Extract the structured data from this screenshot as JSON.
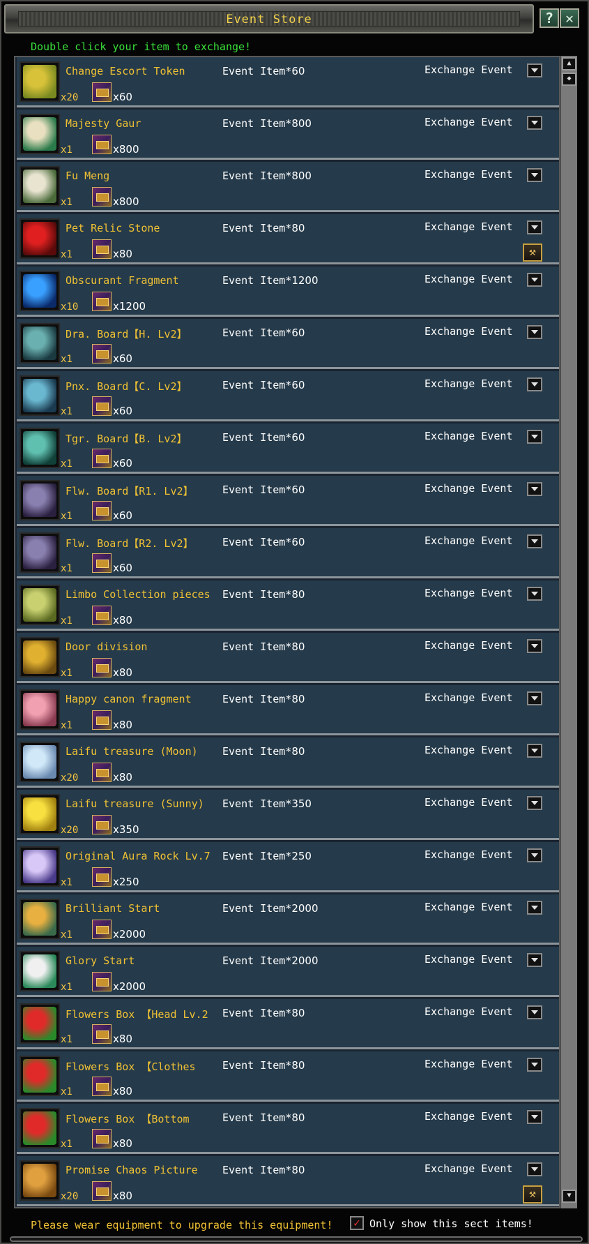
{
  "window": {
    "title": "Event Store",
    "help_label": "?",
    "close_label": "✕",
    "hint": "Double click your item to exchange!"
  },
  "items": [
    {
      "name": "Change Escort Token",
      "qty": "x20",
      "cost_qty": "x60",
      "price_label": "Event Item*",
      "price": "60",
      "exchange": "Exchange Event",
      "icon": "escort-token-icon",
      "colors": [
        "#d8c23a",
        "#7a8a20"
      ]
    },
    {
      "name": "Majesty Gaur",
      "qty": "x1",
      "cost_qty": "x800",
      "price_label": "Event Item*",
      "price": "800",
      "exchange": "Exchange Event",
      "icon": "gaur-mount-icon",
      "colors": [
        "#e8e0c0",
        "#2a7a4a"
      ]
    },
    {
      "name": "Fu Meng",
      "qty": "x1",
      "cost_qty": "x800",
      "price_label": "Event Item*",
      "price": "800",
      "exchange": "Exchange Event",
      "icon": "fu-meng-mount-icon",
      "colors": [
        "#e8e4d0",
        "#4a6a3a"
      ]
    },
    {
      "name": "Pet Relic Stone",
      "qty": "x1",
      "cost_qty": "x80",
      "price_label": "Event Item*",
      "price": "80",
      "exchange": "Exchange Event",
      "icon": "relic-stone-icon",
      "colors": [
        "#e02020",
        "#5a0a0a"
      ],
      "upgrade": true
    },
    {
      "name": "Obscurant Fragment",
      "qty": "x10",
      "cost_qty": "x1200",
      "price_label": "Event Item*",
      "price": "1200",
      "exchange": "Exchange Event",
      "icon": "crystal-fragment-icon",
      "colors": [
        "#3aa0ff",
        "#0a2a6a"
      ]
    },
    {
      "name": "Dra. Board【H. Lv2】",
      "qty": "x1",
      "cost_qty": "x60",
      "price_label": "Event Item*",
      "price": "60",
      "exchange": "Exchange Event",
      "icon": "board-icon",
      "colors": [
        "#6ab0b0",
        "#1a3a40"
      ]
    },
    {
      "name": "Pnx. Board【C. Lv2】",
      "qty": "x1",
      "cost_qty": "x60",
      "price_label": "Event Item*",
      "price": "60",
      "exchange": "Exchange Event",
      "icon": "board-icon",
      "colors": [
        "#6ab8d0",
        "#1a3a50"
      ]
    },
    {
      "name": "Tgr. Board【B. Lv2】",
      "qty": "x1",
      "cost_qty": "x60",
      "price_label": "Event Item*",
      "price": "60",
      "exchange": "Exchange Event",
      "icon": "board-icon",
      "colors": [
        "#60c0b0",
        "#104038"
      ]
    },
    {
      "name": "Flw. Board【R1. Lv2】",
      "qty": "x1",
      "cost_qty": "x60",
      "price_label": "Event Item*",
      "price": "60",
      "exchange": "Exchange Event",
      "icon": "board-icon",
      "colors": [
        "#8a80b0",
        "#2a2040"
      ]
    },
    {
      "name": "Flw. Board【R2. Lv2】",
      "qty": "x1",
      "cost_qty": "x60",
      "price_label": "Event Item*",
      "price": "60",
      "exchange": "Exchange Event",
      "icon": "board-icon",
      "colors": [
        "#8a80b0",
        "#2a2040"
      ]
    },
    {
      "name": "Limbo Collection pieces",
      "qty": "x1",
      "cost_qty": "x80",
      "price_label": "Event Item*",
      "price": "80",
      "exchange": "Exchange Event",
      "icon": "collection-pieces-icon",
      "colors": [
        "#c8d070",
        "#5a6a20"
      ]
    },
    {
      "name": "Door division",
      "qty": "x1",
      "cost_qty": "x80",
      "price_label": "Event Item*",
      "price": "80",
      "exchange": "Exchange Event",
      "icon": "door-division-icon",
      "colors": [
        "#e0b030",
        "#6a4a10"
      ]
    },
    {
      "name": "Happy canon fragment",
      "qty": "x1",
      "cost_qty": "x80",
      "price_label": "Event Item*",
      "price": "80",
      "exchange": "Exchange Event",
      "icon": "canon-fragment-icon",
      "colors": [
        "#f0a0b0",
        "#8a3a50"
      ]
    },
    {
      "name": "Laifu treasure (Moon)",
      "qty": "x20",
      "cost_qty": "x80",
      "price_label": "Event Item*",
      "price": "80",
      "exchange": "Exchange Event",
      "icon": "moon-treasure-icon",
      "colors": [
        "#d0e8f8",
        "#6a8ab0"
      ]
    },
    {
      "name": "Laifu treasure (Sunny)",
      "qty": "x20",
      "cost_qty": "x350",
      "price_label": "Event Item*",
      "price": "350",
      "exchange": "Exchange Event",
      "icon": "sunny-treasure-icon",
      "colors": [
        "#f8e040",
        "#a08010"
      ]
    },
    {
      "name": "Original Aura Rock Lv.7",
      "qty": "x1",
      "cost_qty": "x250",
      "price_label": "Event Item*",
      "price": "250",
      "exchange": "Exchange Event",
      "icon": "aura-rock-icon",
      "colors": [
        "#d8c8f8",
        "#4a3a8a"
      ]
    },
    {
      "name": "Brilliant Start",
      "qty": "x1",
      "cost_qty": "x2000",
      "price_label": "Event Item*",
      "price": "2000",
      "exchange": "Exchange Event",
      "icon": "brilliant-start-icon",
      "colors": [
        "#e8b040",
        "#3a6a4a"
      ]
    },
    {
      "name": "Glory Start",
      "qty": "x1",
      "cost_qty": "x2000",
      "price_label": "Event Item*",
      "price": "2000",
      "exchange": "Exchange Event",
      "icon": "glory-start-icon",
      "colors": [
        "#f0f0f0",
        "#2a8a5a"
      ]
    },
    {
      "name": "Flowers Box 【Head Lv.2",
      "qty": "x1",
      "cost_qty": "x80",
      "price_label": "Event Item*",
      "price": "80",
      "exchange": "Exchange Event",
      "icon": "gift-box-icon",
      "colors": [
        "#e02a2a",
        "#2a8a2a"
      ]
    },
    {
      "name": "Flowers Box 【Clothes",
      "qty": "x1",
      "cost_qty": "x80",
      "price_label": "Event Item*",
      "price": "80",
      "exchange": "Exchange Event",
      "icon": "gift-box-icon",
      "colors": [
        "#e02a2a",
        "#2a8a2a"
      ]
    },
    {
      "name": "Flowers Box 【Bottom",
      "qty": "x1",
      "cost_qty": "x80",
      "price_label": "Event Item*",
      "price": "80",
      "exchange": "Exchange Event",
      "icon": "gift-box-icon",
      "colors": [
        "#e02a2a",
        "#2a8a2a"
      ]
    },
    {
      "name": "Promise Chaos Picture",
      "qty": "x20",
      "cost_qty": "x80",
      "price_label": "Event Item*",
      "price": "80",
      "exchange": "Exchange Event",
      "icon": "chaos-picture-icon",
      "colors": [
        "#e0a040",
        "#7a4a10"
      ],
      "upgrade": true
    }
  ],
  "footer": {
    "message": "Please wear equipment to upgrade this equipment!",
    "checkbox_checked": true,
    "checkbox_mark": "✓",
    "checkbox_label": "Only show this sect items!"
  },
  "scrollbar": {
    "up_label": "▲",
    "page_label": "◆"
  }
}
